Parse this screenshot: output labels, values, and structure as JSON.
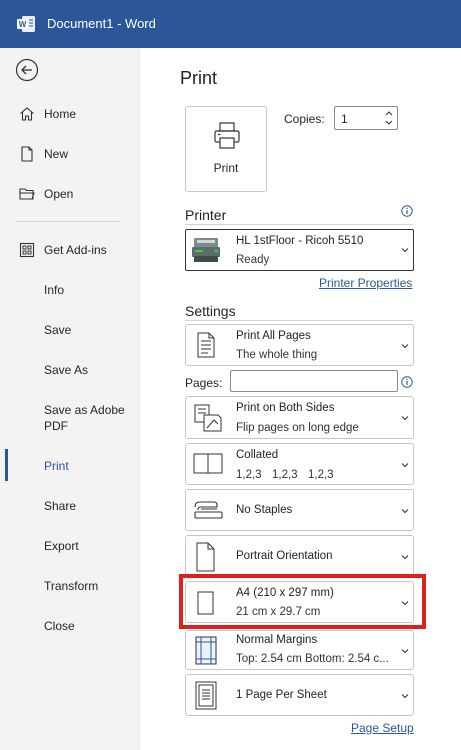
{
  "titlebar": {
    "app_title": "Document1  -  Word",
    "logo_icon": "word-logo-icon",
    "background": "#2b579a"
  },
  "sidebar": {
    "back_icon": "back-arrow-icon",
    "items": [
      {
        "label": "Home",
        "icon": "home-icon"
      },
      {
        "label": "New",
        "icon": "new-document-icon"
      },
      {
        "label": "Open",
        "icon": "open-folder-icon"
      },
      {
        "label": "Get Add-ins",
        "icon": "add-ins-grid-icon"
      },
      {
        "label": "Info"
      },
      {
        "label": "Save"
      },
      {
        "label": "Save As"
      },
      {
        "label": "Save as Adobe PDF"
      },
      {
        "label": "Print",
        "active": true
      },
      {
        "label": "Share"
      },
      {
        "label": "Export"
      },
      {
        "label": "Transform"
      },
      {
        "label": "Close"
      }
    ]
  },
  "print": {
    "title": "Print",
    "print_button_label": "Print",
    "copies_label": "Copies:",
    "copies_value": "1",
    "printer_heading": "Printer",
    "printer_name": "HL 1stFloor - Ricoh 5510",
    "printer_status": "Ready",
    "printer_properties_link": "Printer Properties",
    "settings_heading": "Settings",
    "pages_label": "Pages:",
    "pages_value": "",
    "page_setup_link": "Page Setup",
    "accent_color": "#2b579a",
    "highlight_color": "#e0201f"
  },
  "settings": {
    "range": {
      "line1": "Print All Pages",
      "line2": "The whole thing"
    },
    "sides": {
      "line1": "Print on Both Sides",
      "line2": "Flip pages on long edge"
    },
    "collate": {
      "line1": "Collated",
      "nums": [
        "1,2,3",
        "1,2,3",
        "1,2,3"
      ]
    },
    "staples": {
      "line1": "No Staples"
    },
    "orientation": {
      "line1": "Portrait Orientation"
    },
    "paper": {
      "line1": "A4 (210 x 297 mm)",
      "line2": "21 cm x 29.7 cm"
    },
    "margins": {
      "line1": "Normal Margins",
      "line2": "Top: 2.54 cm Bottom: 2.54 c..."
    },
    "per_sheet": {
      "line1": "1 Page Per Sheet"
    }
  }
}
